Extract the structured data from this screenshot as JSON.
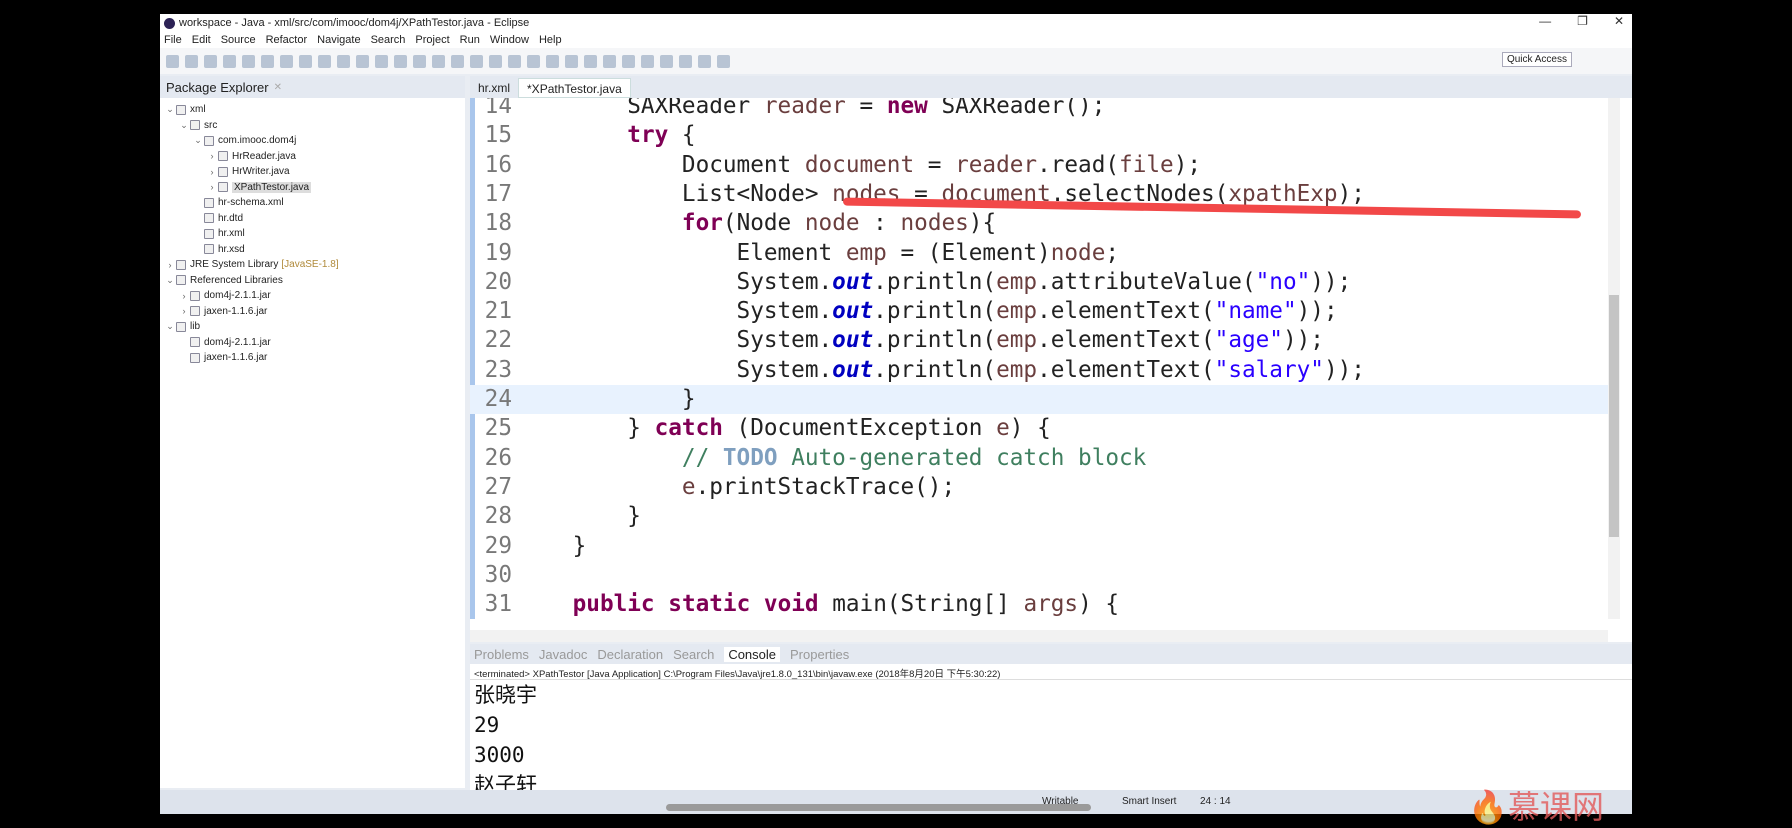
{
  "title": "workspace - Java - xml/src/com/imooc/dom4j/XPathTestor.java - Eclipse",
  "window_buttons": [
    "—",
    "❐",
    "✕"
  ],
  "menu": [
    "File",
    "Edit",
    "Source",
    "Refactor",
    "Navigate",
    "Search",
    "Project",
    "Run",
    "Window",
    "Help"
  ],
  "quick_access": "Quick Access",
  "package_explorer": {
    "title": "Package Explorer",
    "items": [
      {
        "label": "xml",
        "depth": 0,
        "twisty": "v",
        "icon": "project-icon"
      },
      {
        "label": "src",
        "depth": 1,
        "twisty": "v",
        "icon": "source-folder-icon"
      },
      {
        "label": "com.imooc.dom4j",
        "depth": 2,
        "twisty": "v",
        "icon": "package-icon"
      },
      {
        "label": "HrReader.java",
        "depth": 3,
        "twisty": ">",
        "icon": "java-file-icon"
      },
      {
        "label": "HrWriter.java",
        "depth": 3,
        "twisty": ">",
        "icon": "java-file-icon"
      },
      {
        "label": "XPathTestor.java",
        "depth": 3,
        "twisty": ">",
        "icon": "java-file-icon",
        "selected": true
      },
      {
        "label": "hr-schema.xml",
        "depth": 2,
        "twisty": "",
        "icon": "xml-file-icon"
      },
      {
        "label": "hr.dtd",
        "depth": 2,
        "twisty": "",
        "icon": "dtd-file-icon"
      },
      {
        "label": "hr.xml",
        "depth": 2,
        "twisty": "",
        "icon": "xml-file-icon"
      },
      {
        "label": "hr.xsd",
        "depth": 2,
        "twisty": "",
        "icon": "xsd-file-icon"
      },
      {
        "label": "JRE System Library",
        "suffix": "[JavaSE-1.8]",
        "depth": 0,
        "twisty": ">",
        "icon": "library-icon"
      },
      {
        "label": "Referenced Libraries",
        "depth": 0,
        "twisty": "v",
        "icon": "library-icon"
      },
      {
        "label": "dom4j-2.1.1.jar",
        "depth": 1,
        "twisty": ">",
        "icon": "jar-icon"
      },
      {
        "label": "jaxen-1.1.6.jar",
        "depth": 1,
        "twisty": ">",
        "icon": "jar-icon"
      },
      {
        "label": "lib",
        "depth": 0,
        "twisty": "v",
        "icon": "folder-icon"
      },
      {
        "label": "dom4j-2.1.1.jar",
        "depth": 1,
        "twisty": "",
        "icon": "jar-icon"
      },
      {
        "label": "jaxen-1.1.6.jar",
        "depth": 1,
        "twisty": "",
        "icon": "jar-icon"
      }
    ]
  },
  "editor": {
    "tabs": [
      {
        "label": "hr.xml",
        "active": false
      },
      {
        "label": "*XPathTestor.java",
        "active": true
      }
    ],
    "current_line": 24,
    "lines": [
      {
        "n": "14",
        "tokens": [
          [
            "        SAXReader ",
            ""
          ],
          [
            "reader",
            "var"
          ],
          [
            " = ",
            ""
          ],
          [
            "new",
            "kw"
          ],
          [
            " SAXReader();",
            ""
          ]
        ]
      },
      {
        "n": "15",
        "tokens": [
          [
            "        ",
            ""
          ],
          [
            "try",
            "kw"
          ],
          [
            " {",
            ""
          ]
        ]
      },
      {
        "n": "16",
        "tokens": [
          [
            "            Document ",
            ""
          ],
          [
            "document",
            "var"
          ],
          [
            " = ",
            ""
          ],
          [
            "reader",
            "var"
          ],
          [
            ".read(",
            ""
          ],
          [
            "file",
            "var"
          ],
          [
            ");",
            ""
          ]
        ]
      },
      {
        "n": "17",
        "tokens": [
          [
            "            List<Node> ",
            ""
          ],
          [
            "nodes",
            "var"
          ],
          [
            " = ",
            ""
          ],
          [
            "document",
            "var"
          ],
          [
            ".selectNodes(",
            ""
          ],
          [
            "xpathExp",
            "var"
          ],
          [
            ");",
            ""
          ]
        ]
      },
      {
        "n": "18",
        "tokens": [
          [
            "            ",
            ""
          ],
          [
            "for",
            "kw"
          ],
          [
            "(Node ",
            ""
          ],
          [
            "node",
            "var"
          ],
          [
            " : ",
            ""
          ],
          [
            "nodes",
            "var"
          ],
          [
            "){",
            ""
          ]
        ]
      },
      {
        "n": "19",
        "tokens": [
          [
            "                Element ",
            ""
          ],
          [
            "emp",
            "var"
          ],
          [
            " = (Element)",
            ""
          ],
          [
            "node",
            "var"
          ],
          [
            ";",
            ""
          ]
        ]
      },
      {
        "n": "20",
        "tokens": [
          [
            "                System.",
            ""
          ],
          [
            "out",
            "field"
          ],
          [
            ".println(",
            ""
          ],
          [
            "emp",
            "var"
          ],
          [
            ".attributeValue(",
            ""
          ],
          [
            "\"no\"",
            "str"
          ],
          [
            "));",
            ""
          ]
        ]
      },
      {
        "n": "21",
        "tokens": [
          [
            "                System.",
            ""
          ],
          [
            "out",
            "field"
          ],
          [
            ".println(",
            ""
          ],
          [
            "emp",
            "var"
          ],
          [
            ".elementText(",
            ""
          ],
          [
            "\"name\"",
            "str"
          ],
          [
            "));",
            ""
          ]
        ]
      },
      {
        "n": "22",
        "tokens": [
          [
            "                System.",
            ""
          ],
          [
            "out",
            "field"
          ],
          [
            ".println(",
            ""
          ],
          [
            "emp",
            "var"
          ],
          [
            ".elementText(",
            ""
          ],
          [
            "\"age\"",
            "str"
          ],
          [
            "));",
            ""
          ]
        ]
      },
      {
        "n": "23",
        "tokens": [
          [
            "                System.",
            ""
          ],
          [
            "out",
            "field"
          ],
          [
            ".println(",
            ""
          ],
          [
            "emp",
            "var"
          ],
          [
            ".elementText(",
            ""
          ],
          [
            "\"salary\"",
            "str"
          ],
          [
            "));",
            ""
          ]
        ]
      },
      {
        "n": "24",
        "tokens": [
          [
            "            }",
            ""
          ]
        ]
      },
      {
        "n": "25",
        "tokens": [
          [
            "        } ",
            ""
          ],
          [
            "catch",
            "kw"
          ],
          [
            " (DocumentException ",
            ""
          ],
          [
            "e",
            "var"
          ],
          [
            ") {",
            ""
          ]
        ]
      },
      {
        "n": "26",
        "tokens": [
          [
            "            // ",
            "cm"
          ],
          [
            "TODO",
            "todo"
          ],
          [
            " Auto-generated catch block",
            "cm"
          ]
        ]
      },
      {
        "n": "27",
        "tokens": [
          [
            "            ",
            ""
          ],
          [
            "e",
            "var"
          ],
          [
            ".printStackTrace();",
            ""
          ]
        ]
      },
      {
        "n": "28",
        "tokens": [
          [
            "        }",
            ""
          ]
        ]
      },
      {
        "n": "29",
        "tokens": [
          [
            "    }",
            ""
          ]
        ]
      },
      {
        "n": "30",
        "tokens": []
      },
      {
        "n": "31",
        "tokens": [
          [
            "    ",
            ""
          ],
          [
            "public",
            "kw"
          ],
          [
            " ",
            ""
          ],
          [
            "static",
            "kw"
          ],
          [
            " ",
            ""
          ],
          [
            "void",
            "kw"
          ],
          [
            " main(String[] ",
            ""
          ],
          [
            "args",
            "var"
          ],
          [
            ") {",
            ""
          ]
        ]
      }
    ]
  },
  "bottom": {
    "tabs": [
      {
        "label": "Problems"
      },
      {
        "label": "Javadoc"
      },
      {
        "label": "Declaration"
      },
      {
        "label": "Search"
      },
      {
        "label": "Console",
        "active": true
      },
      {
        "label": "Properties"
      }
    ],
    "terminated": "<terminated> XPathTestor [Java Application] C:\\Program Files\\Java\\jre1.8.0_131\\bin\\javaw.exe (2018年8月20日 下午5:30:22)",
    "output": [
      "张晓宇",
      "29",
      "3000",
      "赵子轩"
    ]
  },
  "status": {
    "writable": "Writable",
    "insert": "Smart Insert",
    "position": "24 : 14"
  },
  "watermark": "慕课网",
  "colors": {
    "keyword": "#7f0055",
    "string": "#2a00ff",
    "field": "#0000c0",
    "annotation_stroke": "#f24848"
  }
}
